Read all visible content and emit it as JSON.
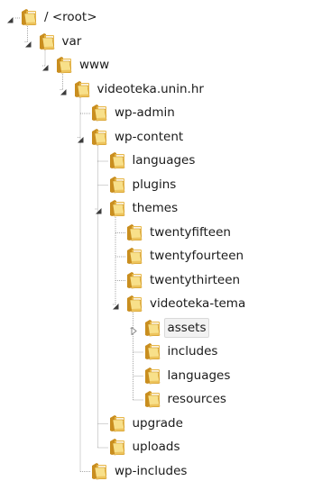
{
  "tree": [
    {
      "label": "/ <root>",
      "depth": 0,
      "toggle": "expanded"
    },
    {
      "label": "var",
      "depth": 1,
      "toggle": "expanded"
    },
    {
      "label": "www",
      "depth": 2,
      "toggle": "expanded"
    },
    {
      "label": "videoteka.unin.hr",
      "depth": 3,
      "toggle": "expanded"
    },
    {
      "label": "wp-admin",
      "depth": 4,
      "toggle": "none"
    },
    {
      "label": "wp-content",
      "depth": 4,
      "toggle": "expanded"
    },
    {
      "label": "languages",
      "depth": 5,
      "toggle": "none"
    },
    {
      "label": "plugins",
      "depth": 5,
      "toggle": "none"
    },
    {
      "label": "themes",
      "depth": 5,
      "toggle": "expanded"
    },
    {
      "label": "twentyfifteen",
      "depth": 6,
      "toggle": "none"
    },
    {
      "label": "twentyfourteen",
      "depth": 6,
      "toggle": "none"
    },
    {
      "label": "twentythirteen",
      "depth": 6,
      "toggle": "none"
    },
    {
      "label": "videoteka-tema",
      "depth": 6,
      "toggle": "expanded"
    },
    {
      "label": "assets",
      "depth": 7,
      "toggle": "collapsed",
      "selected": true
    },
    {
      "label": "includes",
      "depth": 7,
      "toggle": "none"
    },
    {
      "label": "languages",
      "depth": 7,
      "toggle": "none"
    },
    {
      "label": "resources",
      "depth": 7,
      "toggle": "none"
    },
    {
      "label": "upgrade",
      "depth": 5,
      "toggle": "none"
    },
    {
      "label": "uploads",
      "depth": 5,
      "toggle": "none"
    },
    {
      "label": "wp-includes",
      "depth": 4,
      "toggle": "none"
    }
  ],
  "colors": {
    "folder_light": "#f8e08a",
    "folder_mid": "#e8b84a",
    "folder_dark": "#c98e1f",
    "line": "#a8a8a8",
    "toggle_expanded": "#3c3c3c",
    "toggle_collapsed": "#8a8a8a",
    "selection_bg": "#f2f2f2",
    "selection_border": "#d9d9d9"
  },
  "icons": {
    "folder": "folder-icon",
    "expanded": "triangle-down-icon",
    "collapsed": "triangle-right-icon"
  }
}
